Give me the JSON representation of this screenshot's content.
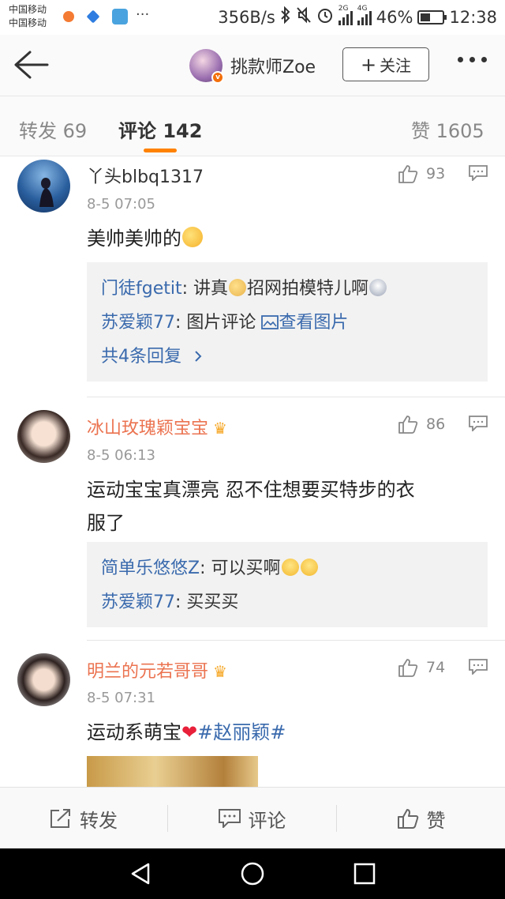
{
  "status_bar": {
    "carrier1": "中国移动",
    "carrier2": "中国移动",
    "more": "···",
    "speed": "356B/s",
    "net1": "2G",
    "net2": "4G",
    "battery_text": "46%",
    "battery_level": 0.46,
    "time": "12:38"
  },
  "nav": {
    "title": "挑款师Zoe",
    "follow_label": "关注",
    "follow_plus": "+"
  },
  "tabs": [
    {
      "label": "转发 69"
    },
    {
      "label": "评论 142"
    },
    {
      "label": "赞 1605"
    }
  ],
  "comments": [
    {
      "user": "丫头blbq1317",
      "time": "8-5 07:05",
      "likes": "93",
      "text": "美帅美帅的",
      "replies": [
        {
          "user": "门徒fgetit",
          "sep": ": ",
          "text_a": "讲真",
          "text_b": "招网拍模特儿啊"
        },
        {
          "user": "苏爱颖77",
          "sep": ": ",
          "text_a": "图片评论 ",
          "link": "查看图片"
        }
      ],
      "more_replies": "共4条回复"
    },
    {
      "user": "冰山玫瑰颖宝宝",
      "time": "8-5 06:13",
      "likes": "86",
      "text_line1": "运动宝宝真漂亮 忍不住想要买特步的衣",
      "text_line2": "服了",
      "replies": [
        {
          "user": "简单乐悠悠Z",
          "sep": ": ",
          "text_a": "可以买啊"
        },
        {
          "user": "苏爱颖77",
          "sep": ": ",
          "text_a": "买买买"
        }
      ]
    },
    {
      "user": "明兰的元若哥哥",
      "time": "8-5 07:31",
      "likes": "74",
      "text": "运动系萌宝",
      "tag": "#赵丽颖#"
    }
  ],
  "actions": {
    "repost": "转发",
    "comment": "评论",
    "like": "赞"
  },
  "colors": {
    "accent": "#ff8200",
    "link": "#3a6aad",
    "vip_name": "#eb7350"
  }
}
